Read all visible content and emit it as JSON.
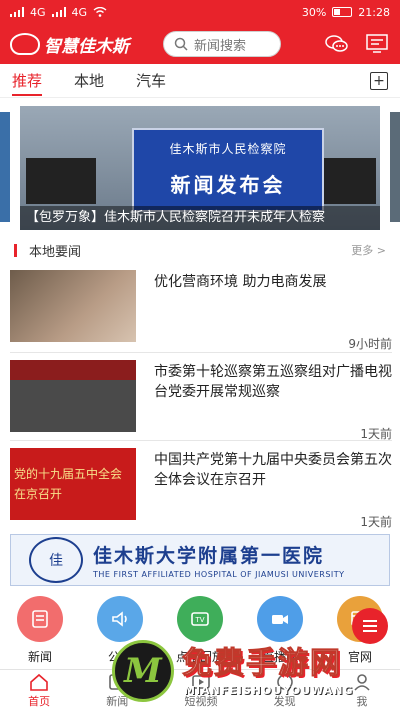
{
  "status_bar": {
    "signal_labels": [
      "4G",
      "4G"
    ],
    "battery": "30%",
    "time": "21:28"
  },
  "header": {
    "logo_text": "智慧佳木斯",
    "search_placeholder": "新闻搜索"
  },
  "tabs": [
    {
      "label": "推荐",
      "active": true
    },
    {
      "label": "本地",
      "active": false
    },
    {
      "label": "汽车",
      "active": false
    }
  ],
  "banner": {
    "screen_line1": "佳木斯市人民检察院",
    "screen_line2": "新闻发布会",
    "caption": "【包罗万象】佳木斯市人民检察院召开未成年人检察"
  },
  "section": {
    "title": "本地要闻",
    "more": "更多 >"
  },
  "news": [
    {
      "headline": "优化营商环境 助力电商发展",
      "time": "9小时前"
    },
    {
      "headline": "市委第十轮巡察第五巡察组对广播电视台党委开展常规巡察",
      "time": "1天前"
    },
    {
      "headline": "中国共产党第十九届中央委员会第五次全体会议在京召开",
      "time": "1天前",
      "thumb_text": "党的十九届五中全会在京召开"
    }
  ],
  "ad": {
    "logo_text": "佳",
    "cn": "佳木斯大学附属第一医院",
    "en": "THE FIRST AFFILIATED HOSPITAL OF JIAMUSI UNIVERSITY"
  },
  "quick_links": [
    {
      "label": "新闻",
      "color": "#f26d6d",
      "icon": "news-icon"
    },
    {
      "label": "公告",
      "color": "#5aa7e8",
      "icon": "speaker-icon"
    },
    {
      "label": "点播回放",
      "color": "#3fae5a",
      "icon": "tv-icon"
    },
    {
      "label": "直播间",
      "color": "#4f9ee8",
      "icon": "video-camera-icon"
    },
    {
      "label": "官网",
      "color": "#e9a13b",
      "icon": "website-icon"
    }
  ],
  "bottom_nav": [
    {
      "label": "首页",
      "active": true
    },
    {
      "label": "新闻",
      "active": false
    },
    {
      "label": "短视频",
      "active": false
    },
    {
      "label": "发现",
      "active": false
    },
    {
      "label": "我",
      "active": false
    }
  ],
  "watermark": {
    "logo_letter": "M",
    "title": "免费手游网",
    "subtitle": "MIANFEISHOUYOUWANG"
  },
  "colors": {
    "brand_red": "#e8232b",
    "ad_blue": "#1d3f8f"
  }
}
